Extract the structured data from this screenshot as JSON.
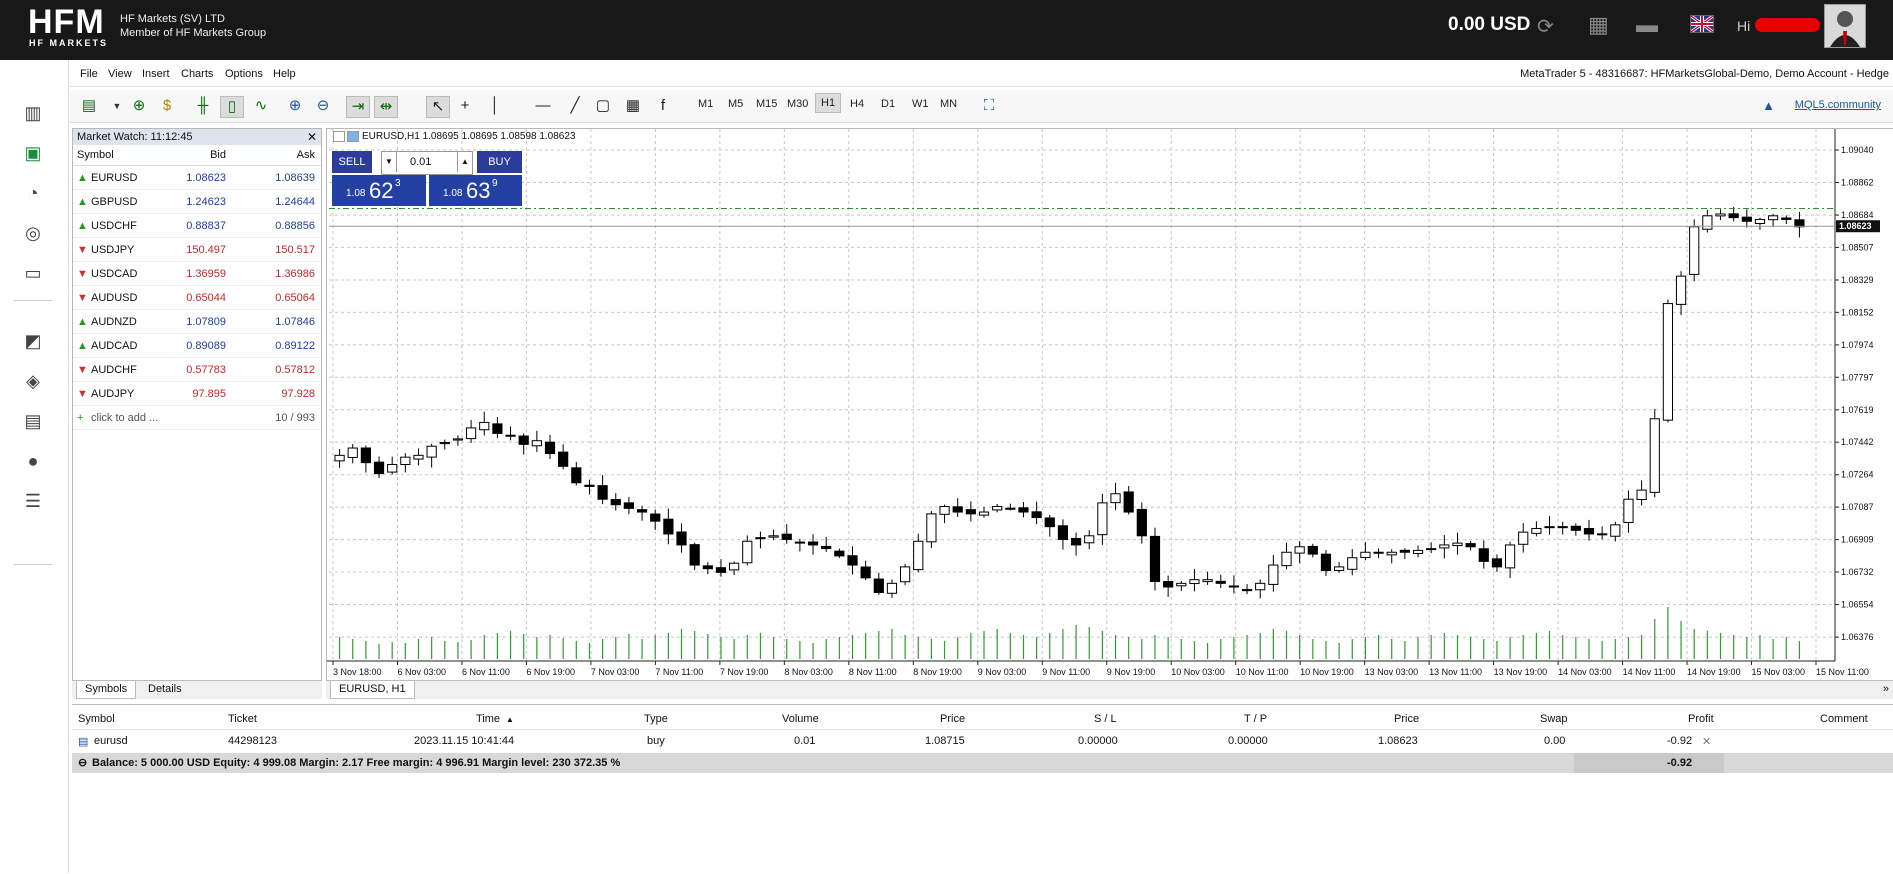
{
  "header": {
    "logo_text": "HFM",
    "logo_sub": "HF MARKETS",
    "company_line1": "HF Markets (SV) LTD",
    "company_line2": "Member of HF Markets Group",
    "balance": "0.00 USD",
    "greeting": "Hi"
  },
  "menu": [
    "File",
    "View",
    "Insert",
    "Charts",
    "Options",
    "Help"
  ],
  "window_title": "MetaTrader 5 - 48316687: HFMarketsGlobal-Demo, Demo Account - Hedge",
  "toolbar": {
    "timeframes": [
      "M1",
      "M5",
      "M15",
      "M30",
      "H1",
      "H4",
      "D1",
      "W1",
      "MN"
    ],
    "active_timeframe": "H1",
    "mql5": "MQL5.community"
  },
  "market_watch": {
    "title": "Market Watch: 11:12:45",
    "columns": [
      "Symbol",
      "Bid",
      "Ask"
    ],
    "rows": [
      {
        "symbol": "EURUSD",
        "bid": "1.08623",
        "ask": "1.08639",
        "dir": "up"
      },
      {
        "symbol": "GBPUSD",
        "bid": "1.24623",
        "ask": "1.24644",
        "dir": "up"
      },
      {
        "symbol": "USDCHF",
        "bid": "0.88837",
        "ask": "0.88856",
        "dir": "up"
      },
      {
        "symbol": "USDJPY",
        "bid": "150.497",
        "ask": "150.517",
        "dir": "down"
      },
      {
        "symbol": "USDCAD",
        "bid": "1.36959",
        "ask": "1.36986",
        "dir": "down"
      },
      {
        "symbol": "AUDUSD",
        "bid": "0.65044",
        "ask": "0.65064",
        "dir": "down"
      },
      {
        "symbol": "AUDNZD",
        "bid": "1.07809",
        "ask": "1.07846",
        "dir": "up"
      },
      {
        "symbol": "AUDCAD",
        "bid": "0.89089",
        "ask": "0.89122",
        "dir": "up"
      },
      {
        "symbol": "AUDCHF",
        "bid": "0.57783",
        "ask": "0.57812",
        "dir": "down"
      },
      {
        "symbol": "AUDJPY",
        "bid": "97.895",
        "ask": "97.928",
        "dir": "down"
      }
    ],
    "add_label": "click to add ...",
    "count": "10 / 993",
    "tabs": [
      "Symbols",
      "Details"
    ]
  },
  "chart": {
    "title": "EURUSD,H1  1.08695 1.08695 1.08598 1.08623",
    "tab": "EURUSD, H1",
    "trade": {
      "sell": "SELL",
      "buy": "BUY",
      "lot": "0.01",
      "sell_big": "1.08",
      "sell_main": "62",
      "sell_sup": "3",
      "buy_big": "1.08",
      "buy_main": "63",
      "buy_sup": "9"
    },
    "current_price_label": "1.08623"
  },
  "chart_data": {
    "type": "candlestick",
    "symbol": "EURUSD",
    "timeframe": "H1",
    "y_ticks": [
      "1.09040",
      "1.08862",
      "1.08684",
      "1.08507",
      "1.08329",
      "1.08152",
      "1.07974",
      "1.07797",
      "1.07619",
      "1.07442",
      "1.07264",
      "1.07087",
      "1.06909",
      "1.06732",
      "1.06554",
      "1.06376"
    ],
    "x_ticks": [
      "3 Nov 18:00",
      "6 Nov 03:00",
      "6 Nov 11:00",
      "6 Nov 19:00",
      "7 Nov 03:00",
      "7 Nov 11:00",
      "7 Nov 19:00",
      "8 Nov 03:00",
      "8 Nov 11:00",
      "8 Nov 19:00",
      "9 Nov 03:00",
      "9 Nov 11:00",
      "9 Nov 19:00",
      "10 Nov 03:00",
      "10 Nov 11:00",
      "10 Nov 19:00",
      "13 Nov 03:00",
      "13 Nov 11:00",
      "13 Nov 19:00",
      "14 Nov 03:00",
      "14 Nov 11:00",
      "14 Nov 19:00",
      "15 Nov 03:00",
      "15 Nov 11:00"
    ],
    "ylim": [
      1.063,
      1.091
    ],
    "current_price": 1.08623,
    "ask_line": 1.0872,
    "close_path": [
      1.0737,
      1.0741,
      1.0733,
      1.0727,
      1.0732,
      1.0736,
      1.0737,
      1.0742,
      1.0744,
      1.0746,
      1.0752,
      1.0755,
      1.0749,
      1.0748,
      1.0743,
      1.0745,
      1.0738,
      1.0731,
      1.0722,
      1.072,
      1.0713,
      1.071,
      1.0708,
      1.0706,
      1.0701,
      1.0694,
      1.0688,
      1.0677,
      1.0675,
      1.0673,
      1.0678,
      1.069,
      1.0692,
      1.0693,
      1.0691,
      1.0689,
      1.0688,
      1.0686,
      1.0682,
      1.0677,
      1.067,
      1.0662,
      1.0667,
      1.0676,
      1.069,
      1.0705,
      1.0709,
      1.0706,
      1.0705,
      1.0706,
      1.0709,
      1.0708,
      1.0706,
      1.0703,
      1.0698,
      1.0691,
      1.0688,
      1.0693,
      1.0711,
      1.0716,
      1.0706,
      1.0693,
      1.0668,
      1.0665,
      1.0667,
      1.0669,
      1.0669,
      1.0667,
      1.0665,
      1.0663,
      1.0667,
      1.0677,
      1.0684,
      1.0687,
      1.0683,
      1.0674,
      1.0676,
      1.0681,
      1.0684,
      1.0684,
      1.0684,
      1.0684,
      1.0685,
      1.0686,
      1.0688,
      1.0689,
      1.0687,
      1.0679,
      1.0676,
      1.0688,
      1.0695,
      1.0697,
      1.0698,
      1.0698,
      1.0696,
      1.0694,
      1.0694,
      1.0699,
      1.0713,
      1.0718,
      1.0757,
      1.082,
      1.0835,
      1.0862,
      1.0868,
      1.0869,
      1.0867,
      1.0865,
      1.0866,
      1.0868,
      1.0866,
      1.0862
    ],
    "volume": [
      22,
      20,
      18,
      15,
      17,
      16,
      20,
      22,
      18,
      17,
      19,
      24,
      26,
      28,
      25,
      22,
      24,
      21,
      18,
      16,
      20,
      22,
      25,
      20,
      24,
      26,
      30,
      28,
      25,
      22,
      20,
      24,
      26,
      22,
      20,
      18,
      16,
      20,
      22,
      24,
      26,
      28,
      30,
      24,
      22,
      20,
      18,
      22,
      26,
      28,
      30,
      26,
      24,
      22,
      26,
      30,
      34,
      32,
      28,
      24,
      22,
      20,
      24,
      22,
      20,
      18,
      16,
      20,
      22,
      24,
      26,
      30,
      28,
      24,
      20,
      18,
      16,
      20,
      22,
      24,
      20,
      18,
      22,
      24,
      26,
      24,
      22,
      20,
      18,
      22,
      24,
      26,
      28,
      24,
      22,
      20,
      18,
      20,
      22,
      24,
      40,
      52,
      38,
      30,
      28,
      26,
      24,
      22,
      24,
      20,
      22,
      18
    ]
  },
  "positions": {
    "columns": [
      "Symbol",
      "Ticket",
      "Time",
      "Type",
      "Volume",
      "Price",
      "S / L",
      "T / P",
      "Price",
      "Swap",
      "Profit",
      "Comment"
    ],
    "rows": [
      {
        "symbol": "eurusd",
        "ticket": "44298123",
        "time": "2023.11.15 10:41:44",
        "type": "buy",
        "volume": "0.01",
        "price": "1.08715",
        "sl": "0.00000",
        "tp": "0.00000",
        "cur_price": "1.08623",
        "swap": "0.00",
        "profit": "-0.92"
      }
    ],
    "summary": "Balance: 5 000.00 USD  Equity: 4 999.08  Margin: 2.17  Free margin: 4 996.91  Margin level: 230 372.35 %",
    "total_profit": "-0.92"
  }
}
